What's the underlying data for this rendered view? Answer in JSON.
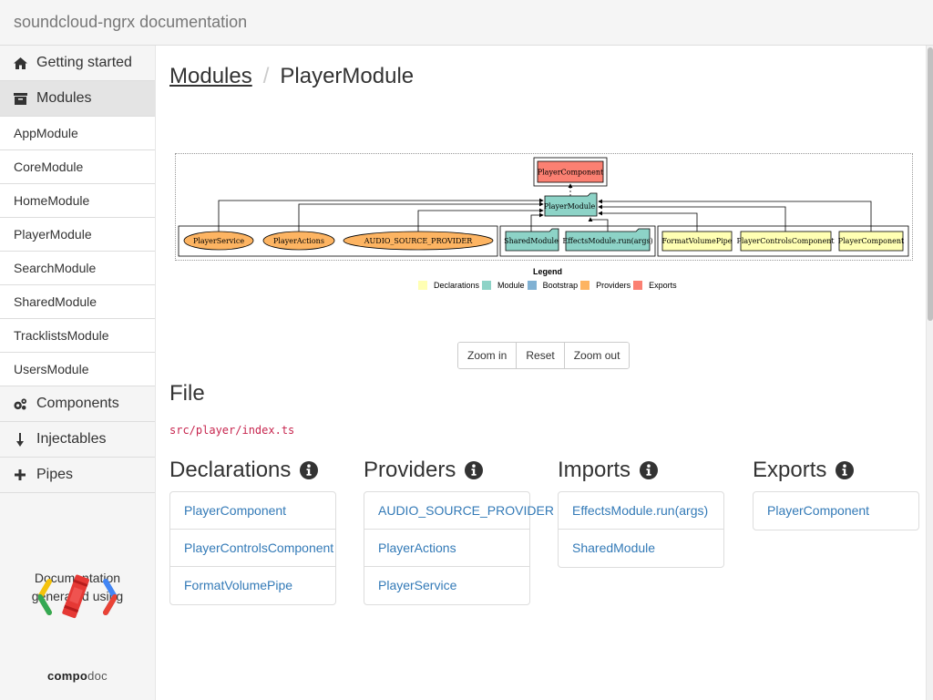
{
  "app": {
    "title": "soundcloud-ngrx documentation"
  },
  "sidebar": {
    "items": [
      {
        "label": "Getting started",
        "icon": "home-icon",
        "type": "chapter"
      },
      {
        "label": "Modules",
        "icon": "archive-icon",
        "type": "chapter",
        "active": true
      },
      {
        "label": "AppModule",
        "type": "sub"
      },
      {
        "label": "CoreModule",
        "type": "sub"
      },
      {
        "label": "HomeModule",
        "type": "sub"
      },
      {
        "label": "PlayerModule",
        "type": "sub"
      },
      {
        "label": "SearchModule",
        "type": "sub"
      },
      {
        "label": "SharedModule",
        "type": "sub"
      },
      {
        "label": "TracklistsModule",
        "type": "sub"
      },
      {
        "label": "UsersModule",
        "type": "sub"
      },
      {
        "label": "Components",
        "icon": "cogs-icon",
        "type": "chapter"
      },
      {
        "label": "Injectables",
        "icon": "arrow-down-icon",
        "type": "chapter"
      },
      {
        "label": "Pipes",
        "icon": "plus-icon",
        "type": "chapter"
      }
    ],
    "credit_line1": "Documentation",
    "credit_line2": "generated using",
    "logo_word_bold": "compo",
    "logo_word_light": "doc"
  },
  "breadcrumb": {
    "parent": "Modules",
    "separator": "/",
    "current": "PlayerModule"
  },
  "graph": {
    "export": "PlayerComponent",
    "module": "PlayerModule",
    "providers": [
      "PlayerService",
      "PlayerActions",
      "AUDIO_SOURCE_PROVIDER"
    ],
    "imports": [
      "SharedModule",
      "EffectsModule.run(args)"
    ],
    "declarations": [
      "FormatVolumePipe",
      "PlayerControlsComponent",
      "PlayerComponent"
    ],
    "legend_title": "Legend",
    "legend": [
      {
        "label": "Declarations",
        "color": "#ffffb3"
      },
      {
        "label": "Module",
        "color": "#8dd3c7"
      },
      {
        "label": "Bootstrap",
        "color": "#80b1d3"
      },
      {
        "label": "Providers",
        "color": "#fdb462"
      },
      {
        "label": "Exports",
        "color": "#fb8072"
      }
    ]
  },
  "zoom": {
    "zoom_in": "Zoom in",
    "reset": "Reset",
    "zoom_out": "Zoom out"
  },
  "file": {
    "heading": "File",
    "path": "src/player/index.ts"
  },
  "sections": {
    "declarations": {
      "title": "Declarations",
      "items": [
        "PlayerComponent",
        "PlayerControlsComponent",
        "FormatVolumePipe"
      ]
    },
    "providers": {
      "title": "Providers",
      "items": [
        "AUDIO_SOURCE_PROVIDER",
        "PlayerActions",
        "PlayerService"
      ]
    },
    "imports": {
      "title": "Imports",
      "items": [
        "EffectsModule.run(args)",
        "SharedModule"
      ]
    },
    "exports": {
      "title": "Exports",
      "items": [
        "PlayerComponent"
      ]
    }
  },
  "colors": {
    "link": "#337ab7",
    "code": "#c7254e",
    "sidebar_bg": "#f5f5f5"
  }
}
